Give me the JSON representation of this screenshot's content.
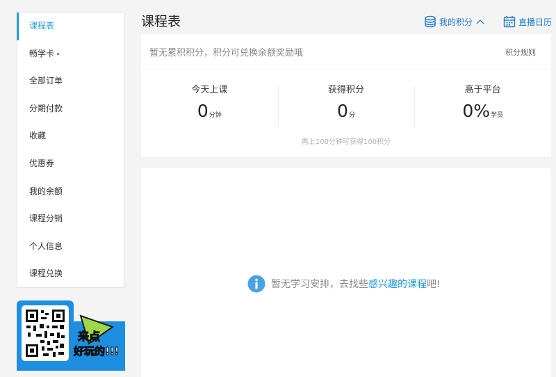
{
  "sidebar": {
    "items": [
      {
        "label": "课程表"
      },
      {
        "label": "畅学卡"
      },
      {
        "label": "全部订单"
      },
      {
        "label": "分期付款"
      },
      {
        "label": "收藏"
      },
      {
        "label": "优惠券"
      },
      {
        "label": "我的余额"
      },
      {
        "label": "课程分销"
      },
      {
        "label": "个人信息"
      },
      {
        "label": "课程兑换"
      }
    ]
  },
  "promo": {
    "line1": "来点",
    "line2": "好玩的!!!"
  },
  "header": {
    "title": "课程表",
    "my_points": "我的积分",
    "live_calendar": "直播日历"
  },
  "points": {
    "notice": "暂无累积积分，积分可兑换余额奖励哦",
    "rules": "积分规则",
    "stats": [
      {
        "label": "今天上课",
        "value": "0",
        "unit": "分钟"
      },
      {
        "label": "获得积分",
        "value": "0",
        "unit": "分"
      },
      {
        "label": "高于平台",
        "value": "0%",
        "unit": "学员"
      }
    ],
    "note": "再上100分钟可获得100积分"
  },
  "empty": {
    "prefix": "暂无学习安排，去找些",
    "link": "感兴趣的课程",
    "suffix": "吧!"
  },
  "colors": {
    "accent": "#1e9ad6",
    "promo_blue": "#1e8fe0",
    "dot_red": "#e8342f"
  }
}
